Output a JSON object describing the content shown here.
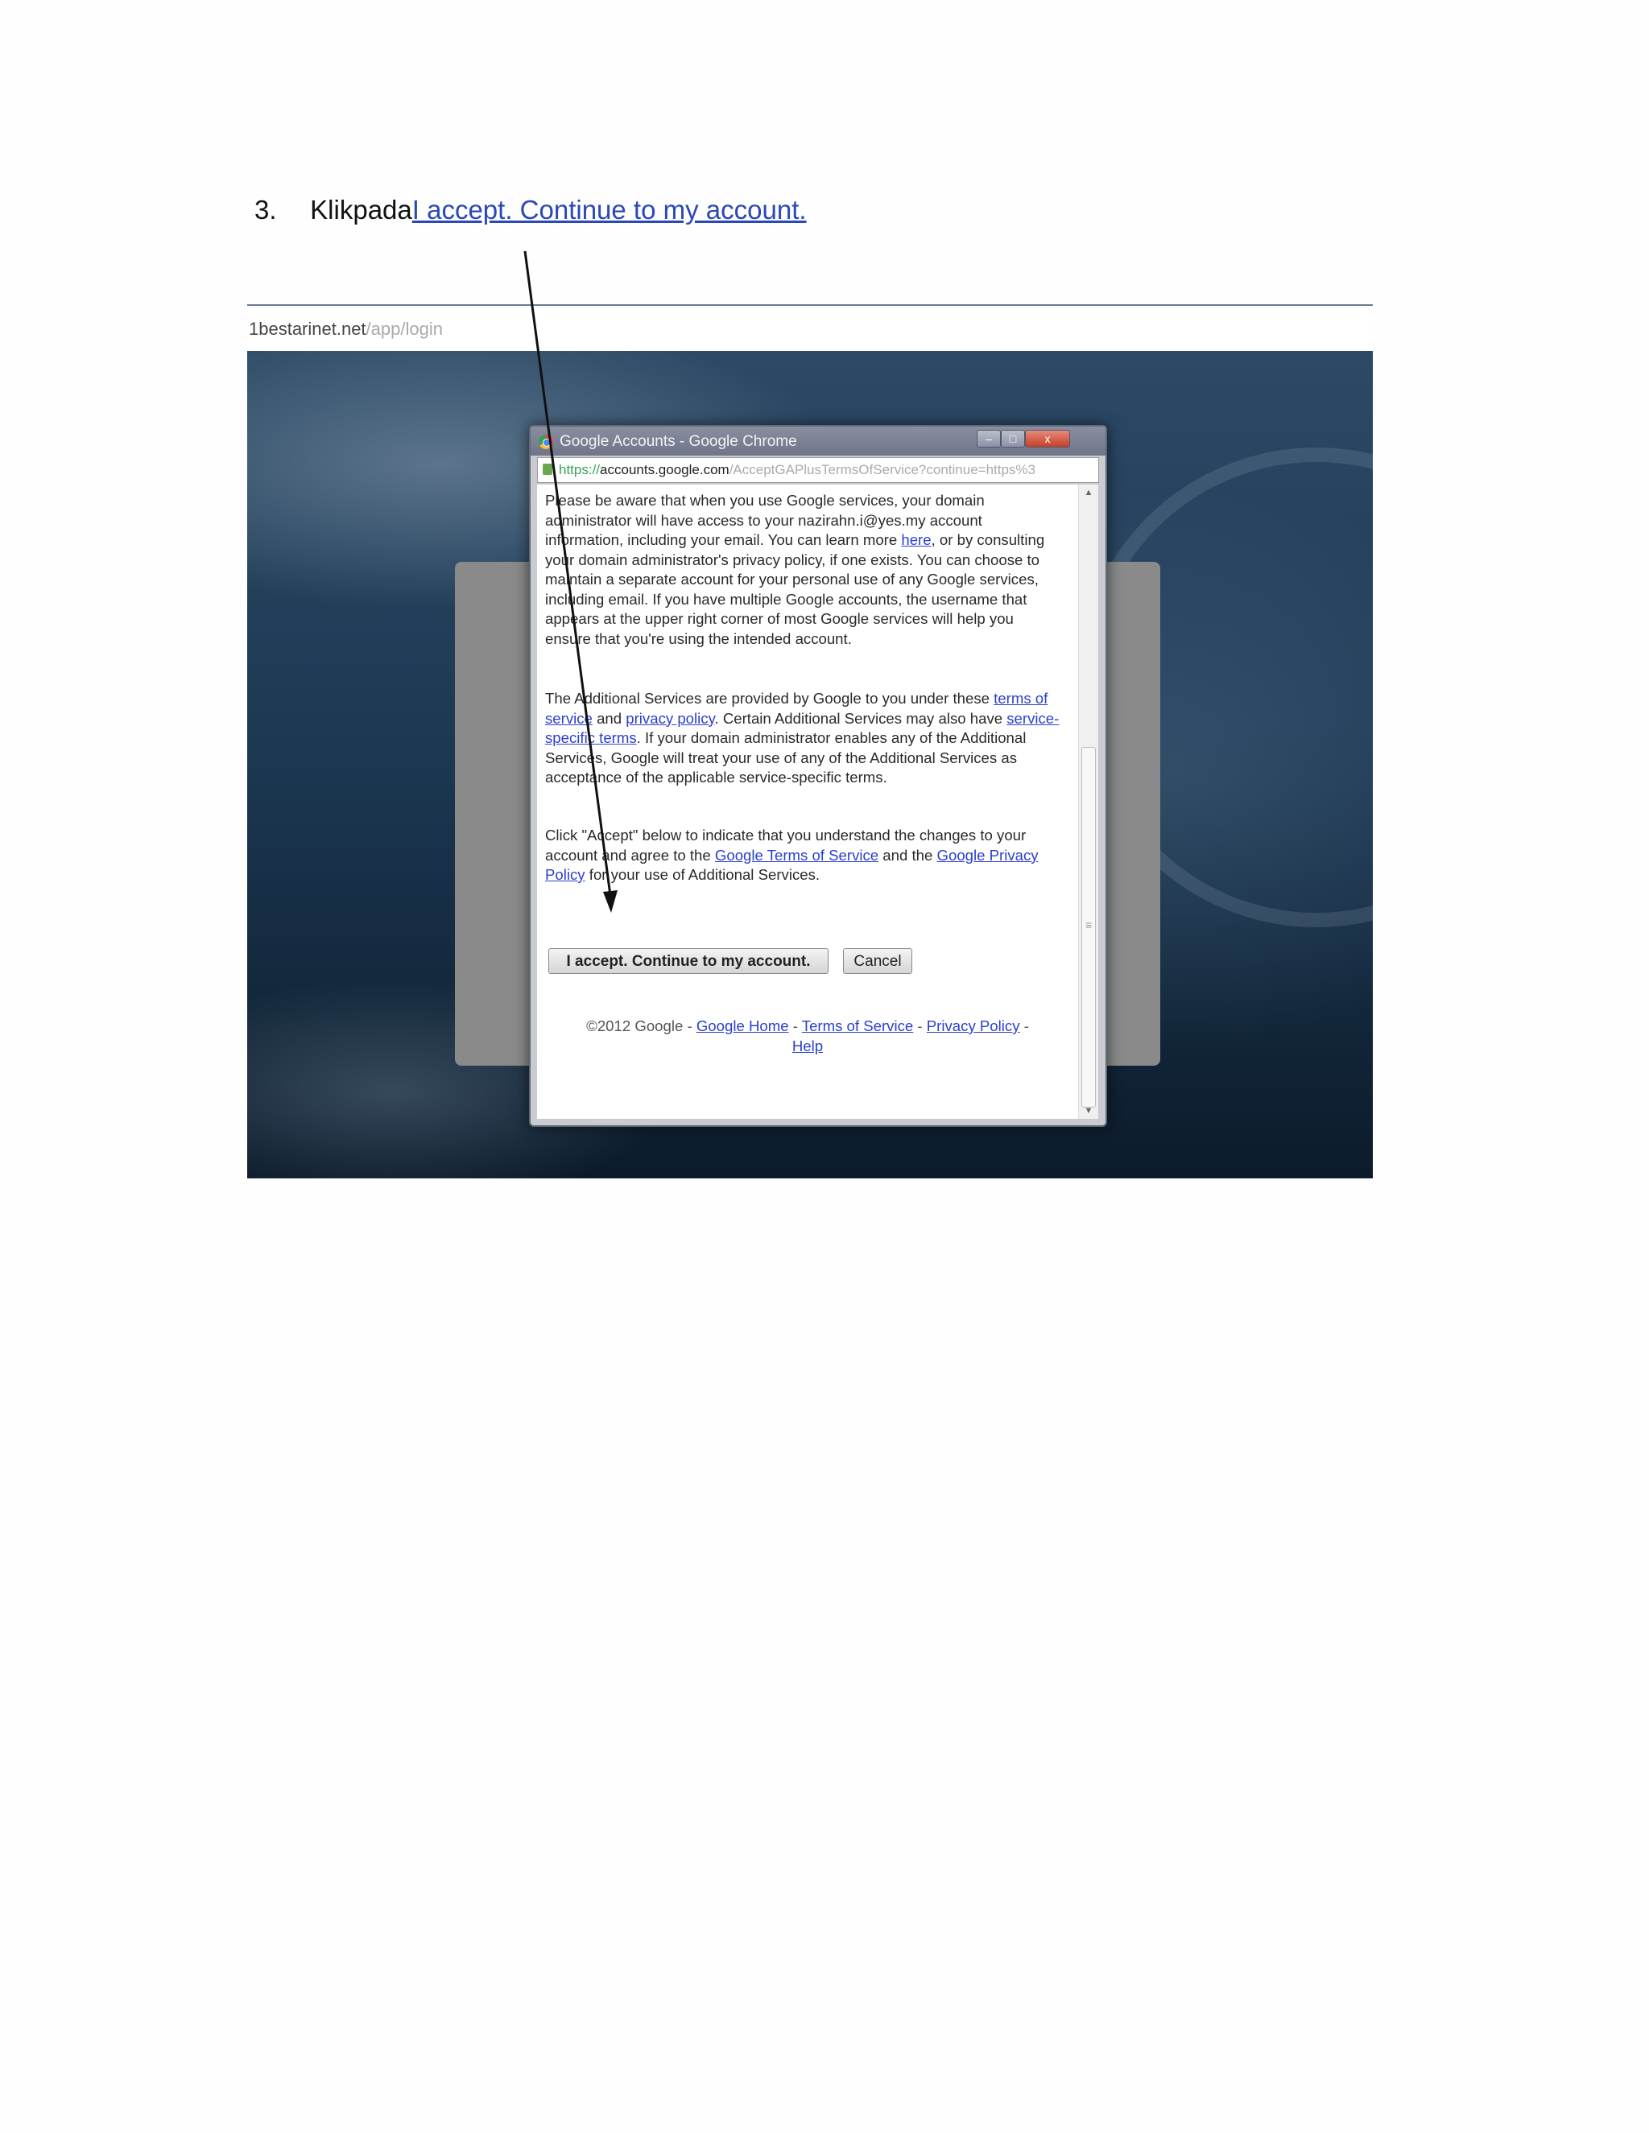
{
  "step": {
    "number": "3.",
    "prefix": "Klikpada",
    "link_text": "I accept. Continue to my account."
  },
  "screenshot": {
    "url_host": "1bestarinet.net",
    "url_path": "/app/login",
    "popup": {
      "title": "Google Accounts - Google Chrome",
      "window_controls": {
        "minimize": "–",
        "maximize": "□",
        "close": "x"
      },
      "address": {
        "scheme": "https://",
        "host": "accounts.google.com",
        "path": "/AcceptGAPlusTermsOfService?continue=https%3"
      },
      "paragraph1": {
        "a": "Please be aware that when you use Google services, your domain administrator will have access to your nazirahn.i@yes.my account information, including your email. You can learn more ",
        "link_here": "here",
        "b": ", or by consulting your domain administrator's privacy policy, if one exists. You can choose to maintain a separate account for your personal use of any Google services, including email. If you have multiple Google accounts, the username that appears at the upper right corner of most Google services will help you ensure that you're using the intended account."
      },
      "paragraph2": {
        "a": "The Additional Services are provided by Google to you under these ",
        "link_terms": "terms of service",
        "b": " and ",
        "link_privacy": "privacy policy",
        "c": ". Certain Additional Services may also have ",
        "link_specific": "service-specific terms",
        "d": ". If your domain administrator enables any of the Additional Services, Google will treat your use of any of the Additional Services as acceptance of the applicable service-specific terms."
      },
      "paragraph3": {
        "a": "Click \"Accept\" below to indicate that you understand the changes to your account and agree to the ",
        "link_gtos": "Google Terms of Service",
        "b": " and the ",
        "link_gpp": "Google Privacy Policy",
        "c": " for your use of Additional Services."
      },
      "accept_button": "I accept. Continue to my account.",
      "cancel_button": "Cancel",
      "footer": {
        "copyright": "©2012 Google - ",
        "home": "Google Home",
        "sep1": " - ",
        "terms": "Terms of Service",
        "sep2": " - ",
        "privacy": "Privacy Policy",
        "sep3": " - ",
        "help": "Help"
      }
    }
  },
  "colors": {
    "link": "#2a48b8",
    "desktop_dark": "#0f2438",
    "panel_gray": "#8a8a8a"
  },
  "icons": [
    "chrome-icon",
    "lock-icon",
    "scroll-up-arrow-icon",
    "scroll-down-arrow-icon",
    "annotation-arrow"
  ]
}
